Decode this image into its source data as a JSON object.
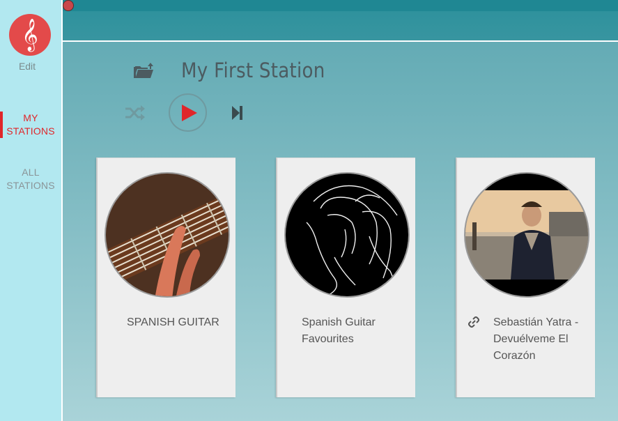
{
  "sidebar": {
    "logo_icon": "treble-clef-icon",
    "logo_glyph": "𝄞",
    "edit_label": "Edit",
    "nav": [
      {
        "label_line1": "MY",
        "label_line2": "STATIONS",
        "active": true
      },
      {
        "label_line1": "ALL",
        "label_line2": "STATIONS",
        "active": false
      }
    ]
  },
  "station": {
    "title": "My First Station",
    "controls": [
      "folder-upload-icon",
      "shuffle-icon",
      "play-icon",
      "skip-next-icon"
    ]
  },
  "cards": [
    {
      "title": "SPANISH GUITAR",
      "art": "guitar-image"
    },
    {
      "title": "Spanish Guitar Favourites",
      "art": "horse-sketch-image"
    },
    {
      "title": "Sebastián Yatra - Devuélveme El Corazón",
      "art": "music-video-thumbnail",
      "icon": "link-icon"
    }
  ],
  "colors": {
    "accent": "#e0262a",
    "logo": "#e34a4a",
    "topbar": "#2f929d",
    "sidebar": "#b2e8f0"
  }
}
